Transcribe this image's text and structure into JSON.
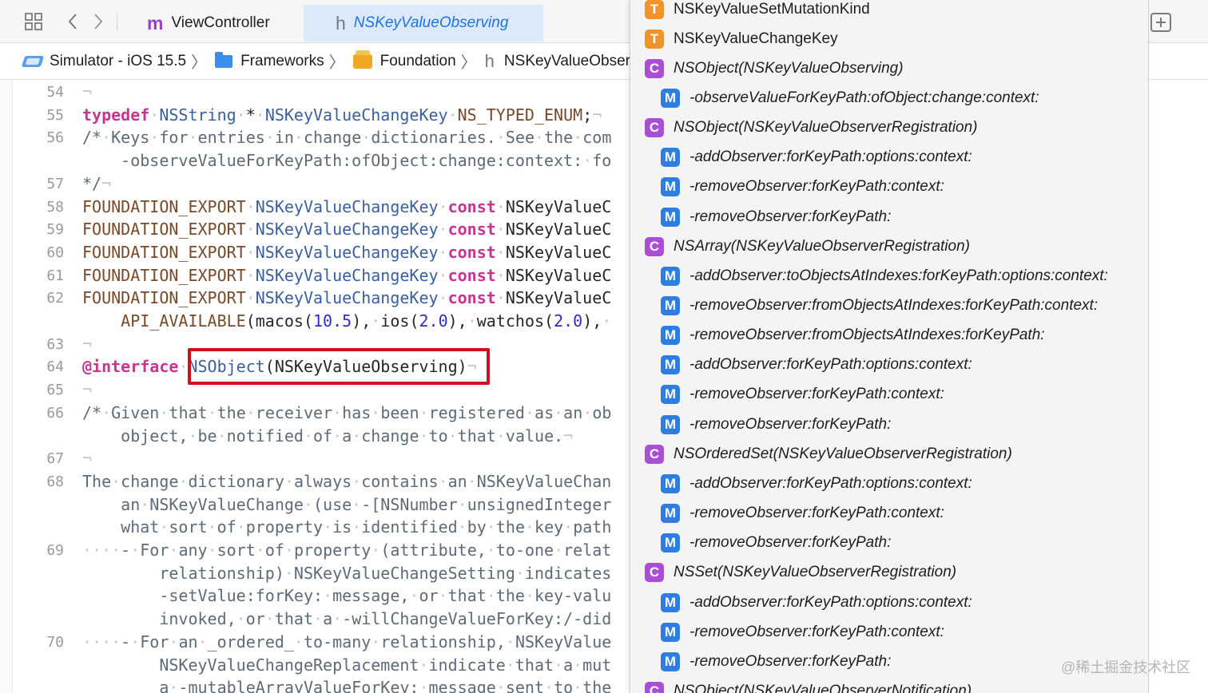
{
  "colors": {
    "type_badge": "#f0932b",
    "class_badge": "#a94fd6",
    "method_badge": "#2f7de1",
    "highlight_border": "#d0101e",
    "active_tab_bg": "#dce9fb"
  },
  "tabs": [
    {
      "glyph": "m",
      "label": "ViewController",
      "active": false
    },
    {
      "glyph": "h",
      "label": "NSKeyValueObserving",
      "active": true
    }
  ],
  "breadcrumb": [
    {
      "icon": "simulator-icon",
      "label": "Simulator - iOS 15.5"
    },
    {
      "icon": "folder-icon",
      "label": "Frameworks"
    },
    {
      "icon": "framework-icon",
      "label": "Foundation"
    },
    {
      "icon": "header-icon",
      "label": "NSKeyValueObservi"
    }
  ],
  "editor": {
    "lines": [
      {
        "num": "54",
        "html": "<span class='ws'>¬</span>"
      },
      {
        "num": "55",
        "html": "<span class='kw'>typedef</span><span class='ws'>·</span><span class='typ'>NSString</span><span class='ws'>·</span>*<span class='ws'>·</span><span class='typ'>NSKeyValueChangeKey</span><span class='ws'>·</span><span class='mac'>NS_TYPED_ENUM</span>;<span class='ws'>¬</span>"
      },
      {
        "num": "56",
        "html": "<span class='cmt'>/*<span class='ws'>·</span>Keys<span class='ws'>·</span>for<span class='ws'>·</span>entries<span class='ws'>·</span>in<span class='ws'>·</span>change<span class='ws'>·</span>dictionaries.<span class='ws'>·</span>See<span class='ws'>·</span>the<span class='ws'>·</span>com</span>"
      },
      {
        "num": "",
        "html": "<span class='cmt'>    -observeValueForKeyPath:ofObject:change:context:<span class='ws'>·</span>fo</span>"
      },
      {
        "num": "57",
        "html": "<span class='cmt'>*/</span><span class='ws'>¬</span>"
      },
      {
        "num": "58",
        "html": "<span class='mac'>FOUNDATION_EXPORT</span><span class='ws'>·</span><span class='typ'>NSKeyValueChangeKey</span><span class='ws'>·</span><span class='kw'>const</span><span class='ws'>·</span>NSKeyValueC"
      },
      {
        "num": "59",
        "html": "<span class='mac'>FOUNDATION_EXPORT</span><span class='ws'>·</span><span class='typ'>NSKeyValueChangeKey</span><span class='ws'>·</span><span class='kw'>const</span><span class='ws'>·</span>NSKeyValueC"
      },
      {
        "num": "60",
        "html": "<span class='mac'>FOUNDATION_EXPORT</span><span class='ws'>·</span><span class='typ'>NSKeyValueChangeKey</span><span class='ws'>·</span><span class='kw'>const</span><span class='ws'>·</span>NSKeyValueC"
      },
      {
        "num": "61",
        "html": "<span class='mac'>FOUNDATION_EXPORT</span><span class='ws'>·</span><span class='typ'>NSKeyValueChangeKey</span><span class='ws'>·</span><span class='kw'>const</span><span class='ws'>·</span>NSKeyValueC"
      },
      {
        "num": "62",
        "html": "<span class='mac'>FOUNDATION_EXPORT</span><span class='ws'>·</span><span class='typ'>NSKeyValueChangeKey</span><span class='ws'>·</span><span class='kw'>const</span><span class='ws'>·</span>NSKeyValueC"
      },
      {
        "num": "",
        "html": "    <span class='mac'>API_AVAILABLE</span>(macos(<span class='num'>10.5</span>),<span class='ws'>·</span>ios(<span class='num'>2.0</span>),<span class='ws'>·</span>watchos(<span class='num'>2.0</span>),<span class='ws'>·</span>"
      },
      {
        "num": "63",
        "html": "<span class='ws'>¬</span>"
      },
      {
        "num": "64",
        "html": "<span class='kw'>@interface</span><span class='ws'>·</span><span class='typ'>NSObject</span>(NSKeyValueObserving)<span class='ws'>¬</span>"
      },
      {
        "num": "65",
        "html": "<span class='ws'>¬</span>"
      },
      {
        "num": "66",
        "html": "<span class='cmt'>/*<span class='ws'>·</span>Given<span class='ws'>·</span>that<span class='ws'>·</span>the<span class='ws'>·</span>receiver<span class='ws'>·</span>has<span class='ws'>·</span>been<span class='ws'>·</span>registered<span class='ws'>·</span>as<span class='ws'>·</span>an<span class='ws'>·</span>ob</span>"
      },
      {
        "num": "",
        "html": "<span class='cmt'>    object,<span class='ws'>·</span>be<span class='ws'>·</span>notified<span class='ws'>·</span>of<span class='ws'>·</span>a<span class='ws'>·</span>change<span class='ws'>·</span>to<span class='ws'>·</span>that<span class='ws'>·</span>value.</span><span class='ws'>¬</span>"
      },
      {
        "num": "67",
        "html": "<span class='ws'>¬</span>"
      },
      {
        "num": "68",
        "html": "<span class='cmt'>The<span class='ws'>·</span>change<span class='ws'>·</span>dictionary<span class='ws'>·</span>always<span class='ws'>·</span>contains<span class='ws'>·</span>an<span class='ws'>·</span>NSKeyValueChan</span>"
      },
      {
        "num": "",
        "html": "<span class='cmt'>    an<span class='ws'>·</span>NSKeyValueChange<span class='ws'>·</span>(use<span class='ws'>·</span>-[NSNumber<span class='ws'>·</span>unsignedInteger</span>"
      },
      {
        "num": "",
        "html": "<span class='cmt'>    what<span class='ws'>·</span>sort<span class='ws'>·</span>of<span class='ws'>·</span>property<span class='ws'>·</span>is<span class='ws'>·</span>identified<span class='ws'>·</span>by<span class='ws'>·</span>the<span class='ws'>·</span>key<span class='ws'>·</span>path</span>"
      },
      {
        "num": "69",
        "html": "<span class='ws'>····</span><span class='cmt'>-<span class='ws'>·</span>For<span class='ws'>·</span>any<span class='ws'>·</span>sort<span class='ws'>·</span>of<span class='ws'>·</span>property<span class='ws'>·</span>(attribute,<span class='ws'>·</span>to-one<span class='ws'>·</span>relat</span>"
      },
      {
        "num": "",
        "html": "<span class='cmt'>        relationship)<span class='ws'>·</span>NSKeyValueChangeSetting<span class='ws'>·</span>indicates</span>"
      },
      {
        "num": "",
        "html": "<span class='cmt'>        -setValue:forKey:<span class='ws'>·</span>message,<span class='ws'>·</span>or<span class='ws'>·</span>that<span class='ws'>·</span>the<span class='ws'>·</span>key-valu</span>"
      },
      {
        "num": "",
        "html": "<span class='cmt'>        invoked,<span class='ws'>·</span>or<span class='ws'>·</span>that<span class='ws'>·</span>a<span class='ws'>·</span>-willChangeValueForKey:/-did</span>"
      },
      {
        "num": "70",
        "html": "<span class='ws'>····</span><span class='cmt'>-<span class='ws'>·</span>For<span class='ws'>·</span>an<span class='ws'>·</span>_ordered_<span class='ws'>·</span>to-many<span class='ws'>·</span>relationship,<span class='ws'>·</span>NSKeyValue</span>"
      },
      {
        "num": "",
        "html": "<span class='cmt'>        NSKeyValueChangeReplacement<span class='ws'>·</span>indicate<span class='ws'>·</span>that<span class='ws'>·</span>a<span class='ws'>·</span>mut</span>"
      },
      {
        "num": "",
        "html": "<span class='cmt'>        a<span class='ws'>·</span>-mutableArrayValueForKey:<span class='ws'>·</span>message<span class='ws'>·</span>sent<span class='ws'>·</span>to<span class='ws'>·</span>the</span>"
      }
    ]
  },
  "popup": {
    "items": [
      {
        "kind": "T",
        "level": 0,
        "label": "NSKeyValueSetMutationKind",
        "italic": false
      },
      {
        "kind": "T",
        "level": 0,
        "label": "NSKeyValueChangeKey",
        "italic": false
      },
      {
        "kind": "C",
        "level": 0,
        "label": "NSObject(NSKeyValueObserving)",
        "italic": true
      },
      {
        "kind": "M",
        "level": 1,
        "label": "-observeValueForKeyPath:ofObject:change:context:",
        "italic": true
      },
      {
        "kind": "C",
        "level": 0,
        "label": "NSObject(NSKeyValueObserverRegistration)",
        "italic": true
      },
      {
        "kind": "M",
        "level": 1,
        "label": "-addObserver:forKeyPath:options:context:",
        "italic": true
      },
      {
        "kind": "M",
        "level": 1,
        "label": "-removeObserver:forKeyPath:context:",
        "italic": true
      },
      {
        "kind": "M",
        "level": 1,
        "label": "-removeObserver:forKeyPath:",
        "italic": true
      },
      {
        "kind": "C",
        "level": 0,
        "label": "NSArray(NSKeyValueObserverRegistration)",
        "italic": true
      },
      {
        "kind": "M",
        "level": 1,
        "label": "-addObserver:toObjectsAtIndexes:forKeyPath:options:context:",
        "italic": true
      },
      {
        "kind": "M",
        "level": 1,
        "label": "-removeObserver:fromObjectsAtIndexes:forKeyPath:context:",
        "italic": true
      },
      {
        "kind": "M",
        "level": 1,
        "label": "-removeObserver:fromObjectsAtIndexes:forKeyPath:",
        "italic": true
      },
      {
        "kind": "M",
        "level": 1,
        "label": "-addObserver:forKeyPath:options:context:",
        "italic": true
      },
      {
        "kind": "M",
        "level": 1,
        "label": "-removeObserver:forKeyPath:context:",
        "italic": true
      },
      {
        "kind": "M",
        "level": 1,
        "label": "-removeObserver:forKeyPath:",
        "italic": true
      },
      {
        "kind": "C",
        "level": 0,
        "label": "NSOrderedSet(NSKeyValueObserverRegistration)",
        "italic": true
      },
      {
        "kind": "M",
        "level": 1,
        "label": "-addObserver:forKeyPath:options:context:",
        "italic": true
      },
      {
        "kind": "M",
        "level": 1,
        "label": "-removeObserver:forKeyPath:context:",
        "italic": true
      },
      {
        "kind": "M",
        "level": 1,
        "label": "-removeObserver:forKeyPath:",
        "italic": true
      },
      {
        "kind": "C",
        "level": 0,
        "label": "NSSet(NSKeyValueObserverRegistration)",
        "italic": true
      },
      {
        "kind": "M",
        "level": 1,
        "label": "-addObserver:forKeyPath:options:context:",
        "italic": true
      },
      {
        "kind": "M",
        "level": 1,
        "label": "-removeObserver:forKeyPath:context:",
        "italic": true
      },
      {
        "kind": "M",
        "level": 1,
        "label": "-removeObserver:forKeyPath:",
        "italic": true
      },
      {
        "kind": "C",
        "level": 0,
        "label": "NSObject(NSKeyValueObserverNotification)",
        "italic": true
      }
    ]
  },
  "watermark": "@稀土掘金技术社区"
}
